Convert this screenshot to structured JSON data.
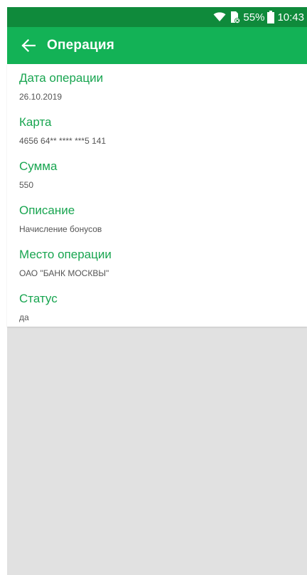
{
  "status_bar": {
    "battery_percent": "55%",
    "time": "10:43",
    "icons": [
      "wifi-icon",
      "no-sim-icon",
      "battery-icon"
    ]
  },
  "app_bar": {
    "title": "Операция",
    "back_icon": "arrow-left-icon"
  },
  "fields": [
    {
      "label": "Дата операции",
      "value": "26.10.2019"
    },
    {
      "label": "Карта",
      "value": "4656 64** **** ***5 141"
    },
    {
      "label": "Сумма",
      "value": "550"
    },
    {
      "label": "Описание",
      "value": "Начисление бонусов"
    },
    {
      "label": "Место операции",
      "value": "ОАО \"БАНК МОСКВЫ\""
    },
    {
      "label": "Статус",
      "value": "да"
    }
  ],
  "colors": {
    "status_bar": "#0f8a3b",
    "app_bar": "#13b256",
    "label": "#18a550",
    "background": "#e1e1e1"
  }
}
